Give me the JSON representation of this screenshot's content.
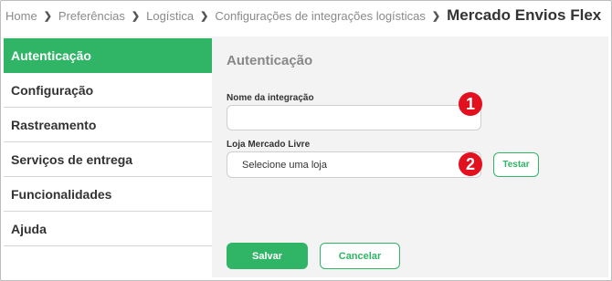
{
  "breadcrumb": {
    "items": [
      "Home",
      "Preferências",
      "Logística",
      "Configurações de integrações logísticas"
    ],
    "current": "Mercado Envios Flex"
  },
  "sidebar": {
    "items": [
      {
        "label": "Autenticação",
        "active": true
      },
      {
        "label": "Configuração",
        "active": false
      },
      {
        "label": "Rastreamento",
        "active": false
      },
      {
        "label": "Serviços de entrega",
        "active": false
      },
      {
        "label": "Funcionalidades",
        "active": false
      },
      {
        "label": "Ajuda",
        "active": false
      }
    ]
  },
  "main": {
    "section_title": "Autenticação",
    "integration_name": {
      "label": "Nome da integração",
      "value": "",
      "placeholder": ""
    },
    "store": {
      "label": "Loja Mercado Livre",
      "selected": "Selecione uma loja"
    },
    "test_button": "Testar",
    "save_button": "Salvar",
    "cancel_button": "Cancelar"
  },
  "annotations": {
    "badge_1": "1",
    "badge_2": "2"
  },
  "colors": {
    "accent": "#2fb565",
    "badge": "#e3101f"
  }
}
